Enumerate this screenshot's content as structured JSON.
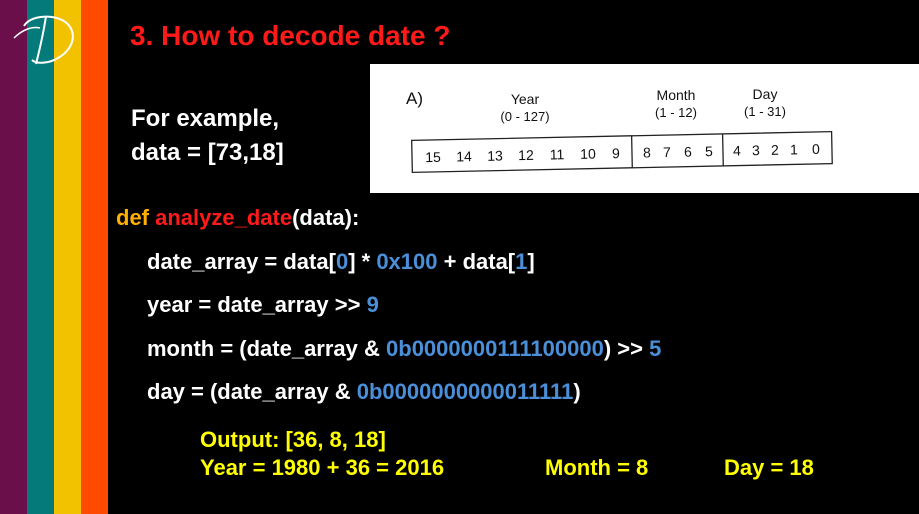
{
  "colors": {
    "stripes": [
      "#6b0f4a",
      "#047a7a",
      "#f2c200",
      "#ff4a00"
    ],
    "title": "#ff1a1a",
    "keyword": "#ffb000",
    "number": "#4a8fd8",
    "output": "#ffff00"
  },
  "logo": {
    "icon": "d-monogram-logo",
    "text": "D"
  },
  "title": "3. How to decode date ?",
  "example": {
    "line1": "For example,",
    "line2": "data = [73,18]"
  },
  "diagram": {
    "label": "A)",
    "fields": [
      {
        "name": "Year",
        "range": "(0 - 127)",
        "bits": [
          "15",
          "14",
          "13",
          "12",
          "11",
          "10",
          "9"
        ]
      },
      {
        "name": "Month",
        "range": "(1 - 12)",
        "bits": [
          "8",
          "7",
          "6",
          "5"
        ]
      },
      {
        "name": "Day",
        "range": "(1 - 31)",
        "bits": [
          "4",
          "3",
          "2",
          "1",
          "0"
        ]
      }
    ]
  },
  "code": {
    "line1": {
      "kw": "def ",
      "fn": "analyze_date",
      "rest": "(data):"
    },
    "line2": {
      "a": "date_array = data[",
      "n1": "0",
      "b": "] * ",
      "n2": "0x100",
      "c": " + data[",
      "n3": "1",
      "d": "]"
    },
    "line3": {
      "a": "year = date_array >> ",
      "n1": "9"
    },
    "line4": {
      "a": "month = (date_array & ",
      "n1": "0b0000000111100000",
      "b": ") >> ",
      "n2": "5"
    },
    "line5": {
      "a": "day = (date_array & ",
      "n1": "0b0000000000011111",
      "b": ")"
    }
  },
  "output": {
    "line1": "Output: [36, 8, 18]",
    "year": "Year = 1980 + 36 = 2016",
    "month": "Month = 8",
    "day": "Day = 18"
  }
}
